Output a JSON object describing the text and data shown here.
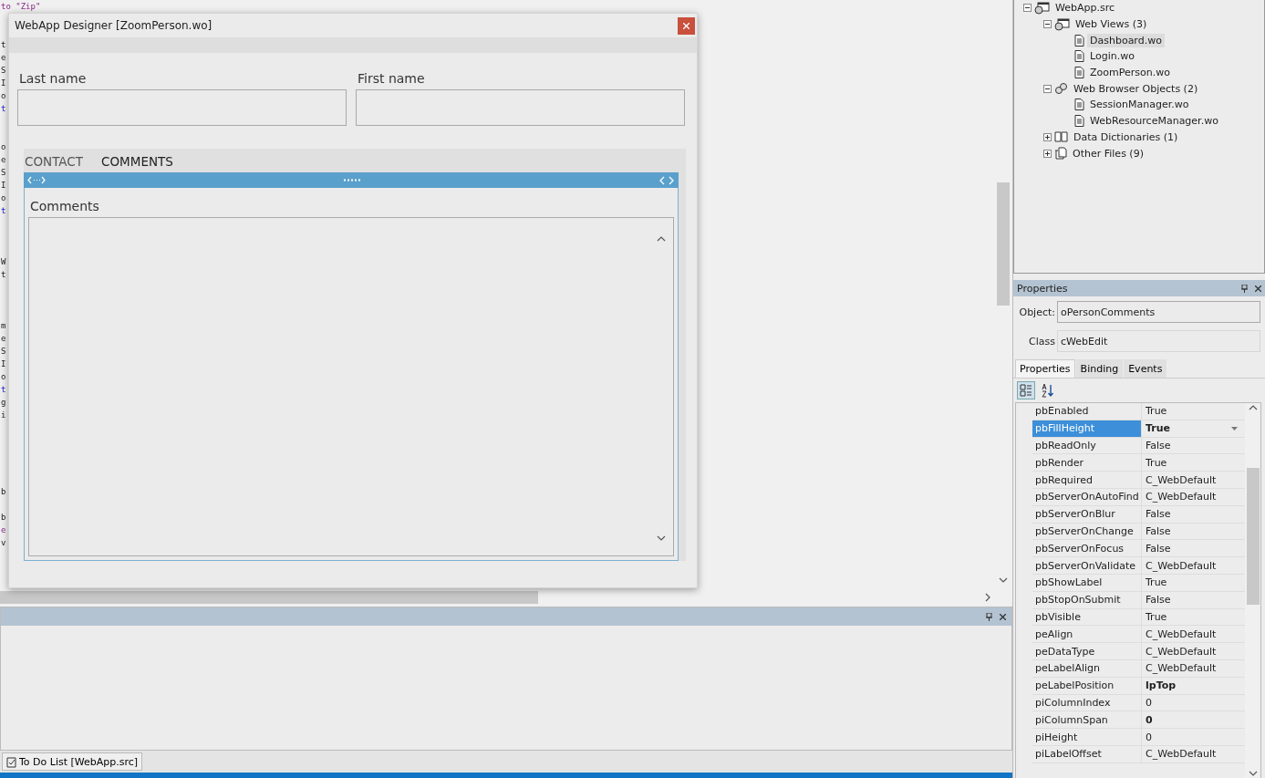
{
  "code_lines": [
    {
      "kind": "string",
      "text": "to \"Zip\""
    },
    {
      "kind": "blank"
    },
    {
      "kind": "blank"
    },
    {
      "kind": "plain",
      "text": "t"
    },
    {
      "kind": "plain",
      "text": "e"
    },
    {
      "kind": "plain",
      "text": "S"
    },
    {
      "kind": "plain",
      "text": "I"
    },
    {
      "kind": "plain",
      "text": "o"
    },
    {
      "kind": "keyword",
      "text": "t"
    },
    {
      "kind": "blank"
    },
    {
      "kind": "blank"
    },
    {
      "kind": "plain",
      "text": "o"
    },
    {
      "kind": "plain",
      "text": "e"
    },
    {
      "kind": "plain",
      "text": "S"
    },
    {
      "kind": "plain",
      "text": "I"
    },
    {
      "kind": "plain",
      "text": "o"
    },
    {
      "kind": "keyword",
      "text": "t"
    },
    {
      "kind": "blank"
    },
    {
      "kind": "blank"
    },
    {
      "kind": "blank"
    },
    {
      "kind": "plain",
      "text": "W"
    },
    {
      "kind": "plain",
      "text": "t"
    },
    {
      "kind": "blank"
    },
    {
      "kind": "blank"
    },
    {
      "kind": "blank"
    },
    {
      "kind": "plain",
      "text": "m"
    },
    {
      "kind": "plain",
      "text": "e"
    },
    {
      "kind": "plain",
      "text": "S"
    },
    {
      "kind": "plain",
      "text": "I"
    },
    {
      "kind": "plain",
      "text": "o"
    },
    {
      "kind": "keyword",
      "text": "t"
    },
    {
      "kind": "plain",
      "text": "g"
    },
    {
      "kind": "plain",
      "text": "i"
    },
    {
      "kind": "blank"
    },
    {
      "kind": "blank"
    },
    {
      "kind": "blank"
    },
    {
      "kind": "blank"
    },
    {
      "kind": "blank"
    },
    {
      "kind": "plain",
      "text": "b"
    },
    {
      "kind": "blank"
    },
    {
      "kind": "plain",
      "text": "b"
    },
    {
      "kind": "string",
      "text": "e"
    },
    {
      "kind": "plain",
      "text": "v"
    }
  ],
  "designer": {
    "title": "WebApp Designer [ZoomPerson.wo]",
    "fields": [
      {
        "label": "Last name"
      },
      {
        "label": "First name"
      }
    ],
    "tabs": [
      {
        "label": "CONTACT",
        "selected": false
      },
      {
        "label": "COMMENTS",
        "selected": true
      }
    ],
    "comments_label": "Comments"
  },
  "tree": [
    {
      "label": "WebApp.src",
      "kind": "project",
      "expanded": true,
      "selected": false,
      "children": [
        {
          "label": "Web Views (3)",
          "kind": "views",
          "expanded": true,
          "selected": false,
          "children": [
            {
              "label": "Dashboard.wo",
              "kind": "file",
              "selected": true
            },
            {
              "label": "Login.wo",
              "kind": "file",
              "selected": false
            },
            {
              "label": "ZoomPerson.wo",
              "kind": "file",
              "selected": false
            }
          ]
        },
        {
          "label": "Web Browser Objects (2)",
          "kind": "objects",
          "expanded": true,
          "selected": false,
          "children": [
            {
              "label": "SessionManager.wo",
              "kind": "file",
              "selected": false
            },
            {
              "label": "WebResourceManager.wo",
              "kind": "file",
              "selected": false
            }
          ]
        },
        {
          "label": "Data Dictionaries (1)",
          "kind": "book",
          "expanded": false,
          "selected": false
        },
        {
          "label": "Other Files (9)",
          "kind": "files",
          "expanded": false,
          "selected": false
        }
      ]
    }
  ],
  "properties_panel": {
    "title": "Properties",
    "object_label": "Object:",
    "object_value": "oPersonComments",
    "class_label": "Class",
    "class_value": "cWebEdit",
    "tabs": [
      {
        "label": "Properties",
        "selected": true
      },
      {
        "label": "Binding",
        "selected": false
      },
      {
        "label": "Events",
        "selected": false
      }
    ],
    "rows": [
      {
        "name": "pbEnabled",
        "value": "True",
        "selected": false,
        "modified": false
      },
      {
        "name": "pbFillHeight",
        "value": "True",
        "selected": true,
        "modified": true
      },
      {
        "name": "pbReadOnly",
        "value": "False",
        "selected": false,
        "modified": false
      },
      {
        "name": "pbRender",
        "value": "True",
        "selected": false,
        "modified": false
      },
      {
        "name": "pbRequired",
        "value": "C_WebDefault",
        "selected": false,
        "modified": false
      },
      {
        "name": "pbServerOnAutoFind",
        "value": "C_WebDefault",
        "selected": false,
        "modified": false
      },
      {
        "name": "pbServerOnBlur",
        "value": "False",
        "selected": false,
        "modified": false
      },
      {
        "name": "pbServerOnChange",
        "value": "False",
        "selected": false,
        "modified": false
      },
      {
        "name": "pbServerOnFocus",
        "value": "False",
        "selected": false,
        "modified": false
      },
      {
        "name": "pbServerOnValidate",
        "value": "C_WebDefault",
        "selected": false,
        "modified": false
      },
      {
        "name": "pbShowLabel",
        "value": "True",
        "selected": false,
        "modified": false
      },
      {
        "name": "pbStopOnSubmit",
        "value": "False",
        "selected": false,
        "modified": false
      },
      {
        "name": "pbVisible",
        "value": "True",
        "selected": false,
        "modified": false
      },
      {
        "name": "peAlign",
        "value": "C_WebDefault",
        "selected": false,
        "modified": false
      },
      {
        "name": "peDataType",
        "value": "C_WebDefault",
        "selected": false,
        "modified": false
      },
      {
        "name": "peLabelAlign",
        "value": "C_WebDefault",
        "selected": false,
        "modified": false
      },
      {
        "name": "peLabelPosition",
        "value": "lpTop",
        "selected": false,
        "modified": true
      },
      {
        "name": "piColumnIndex",
        "value": "0",
        "selected": false,
        "modified": false
      },
      {
        "name": "piColumnSpan",
        "value": "0",
        "selected": false,
        "modified": true
      },
      {
        "name": "piHeight",
        "value": "0",
        "selected": false,
        "modified": false
      },
      {
        "name": "piLabelOffset",
        "value": "C_WebDefault",
        "selected": false,
        "modified": false
      }
    ]
  },
  "bottom_tabs": [
    {
      "label": "To Do List [WebApp.src]",
      "selected": true
    }
  ]
}
